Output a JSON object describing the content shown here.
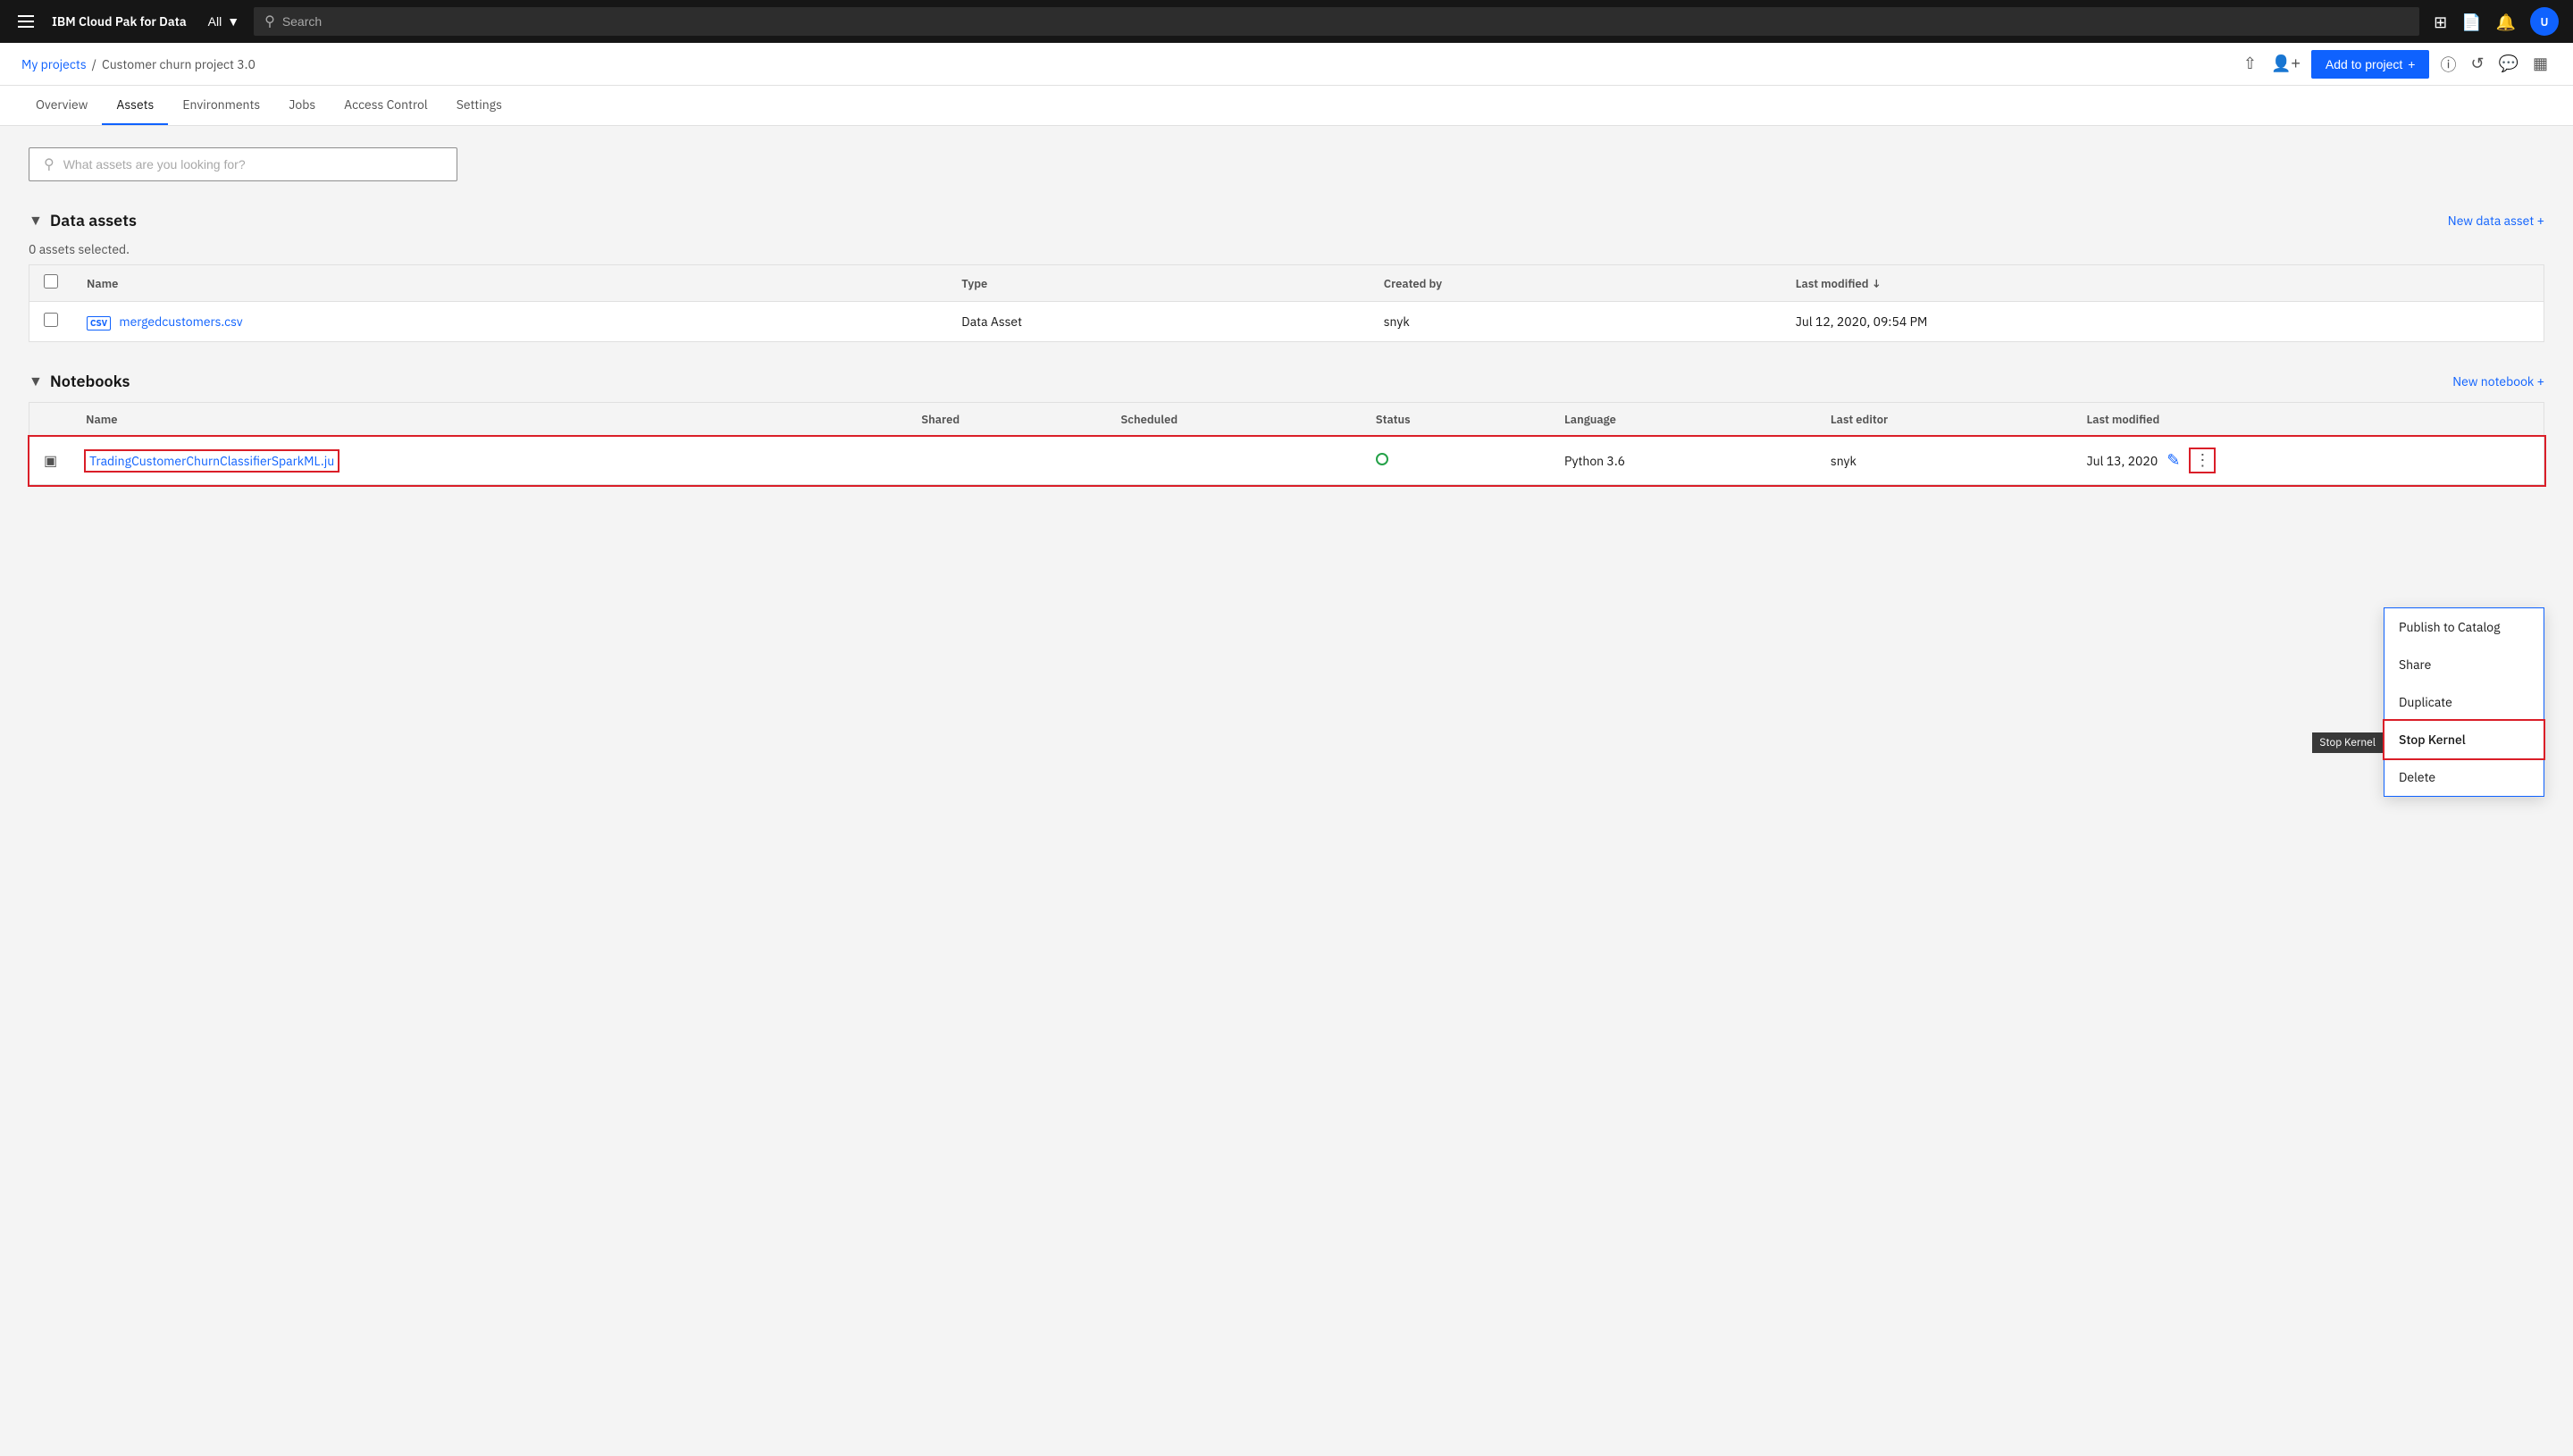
{
  "topnav": {
    "brand": "IBM Cloud Pak for Data",
    "search_placeholder": "Search",
    "all_label": "All",
    "avatar_initials": "U"
  },
  "subnav": {
    "breadcrumb_link": "My projects",
    "breadcrumb_sep": "/",
    "project_name": "Customer churn project 3.0",
    "add_button_label": "Add to project",
    "add_button_plus": "+"
  },
  "tabs": [
    {
      "label": "Overview",
      "active": false
    },
    {
      "label": "Assets",
      "active": true
    },
    {
      "label": "Environments",
      "active": false
    },
    {
      "label": "Jobs",
      "active": false
    },
    {
      "label": "Access Control",
      "active": false
    },
    {
      "label": "Settings",
      "active": false
    }
  ],
  "asset_search": {
    "placeholder": "What assets are you looking for?"
  },
  "data_assets": {
    "section_title": "Data assets",
    "new_link": "New data asset +",
    "selected_info": "0 assets selected.",
    "columns": [
      "Name",
      "Type",
      "Created by",
      "Last modified"
    ],
    "rows": [
      {
        "name": "mergedcustomers.csv",
        "type": "Data Asset",
        "created_by": "snyk",
        "last_modified": "Jul 12, 2020, 09:54 PM",
        "badge": "CSV"
      }
    ]
  },
  "notebooks": {
    "section_title": "Notebooks",
    "new_link": "New notebook +",
    "columns": [
      "Name",
      "Shared",
      "Scheduled",
      "Status",
      "Language",
      "Last editor",
      "Last modified"
    ],
    "rows": [
      {
        "name": "TradingCustomerChurnClassifierSparkML.ju",
        "shared": "",
        "scheduled": "",
        "status": "active",
        "language": "Python 3.6",
        "last_editor": "snyk",
        "last_modified": "Jul 13, 2020"
      }
    ]
  },
  "dropdown_menu": {
    "items": [
      {
        "label": "Publish to Catalog",
        "highlighted": false
      },
      {
        "label": "Share",
        "highlighted": false
      },
      {
        "label": "Duplicate",
        "highlighted": false
      },
      {
        "label": "Stop Kernel",
        "highlighted": true
      },
      {
        "label": "Delete",
        "highlighted": false
      }
    ]
  },
  "tooltip": {
    "text": "Stop Kernel"
  }
}
